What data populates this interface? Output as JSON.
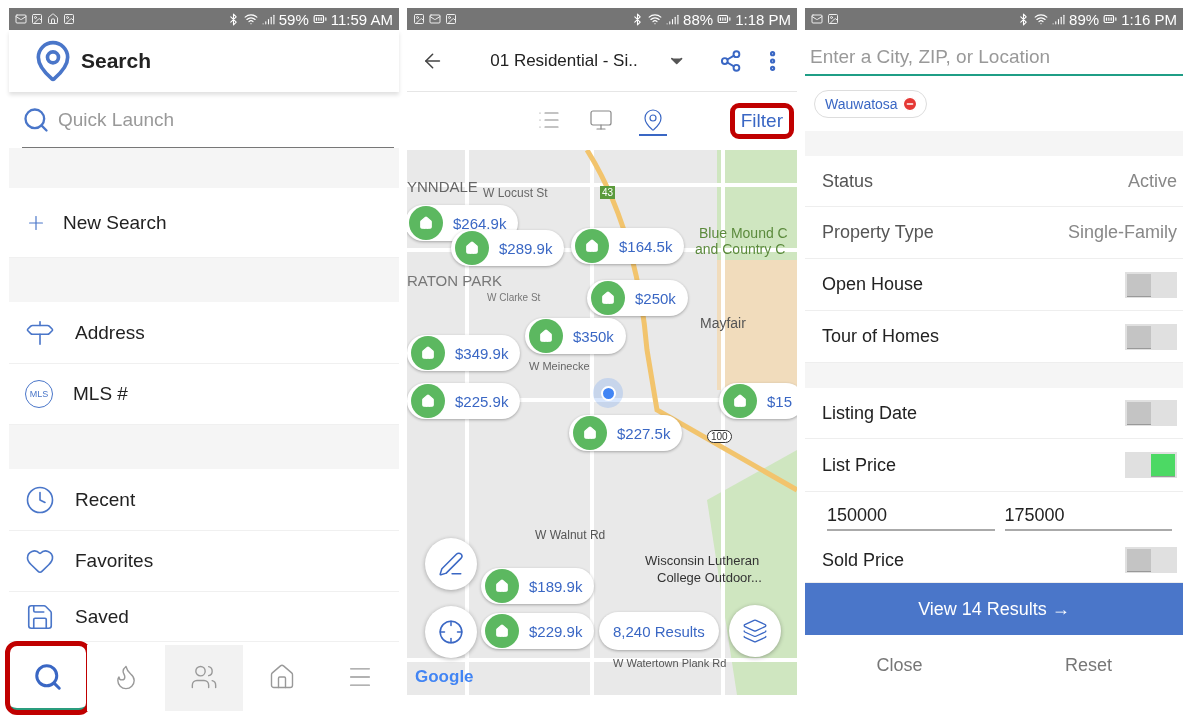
{
  "search_screen": {
    "status_bar": {
      "battery": "59%",
      "time": "11:59 AM"
    },
    "header": {
      "title": "Search"
    },
    "quick_launch": {
      "placeholder": "Quick Launch"
    },
    "groups": [
      [
        {
          "kind": "plus",
          "label": "New Search"
        }
      ],
      [
        {
          "kind": "signpost",
          "label": "Address"
        },
        {
          "kind": "mls",
          "label": "MLS #",
          "badge": "MLS"
        }
      ],
      [
        {
          "kind": "clock",
          "label": "Recent"
        },
        {
          "kind": "heart",
          "label": "Favorites"
        },
        {
          "kind": "floppy",
          "label": "Saved"
        }
      ]
    ],
    "bottom_nav": [
      {
        "kind": "search",
        "selected": true,
        "pressed": false,
        "highlighted": true
      },
      {
        "kind": "flame",
        "selected": false,
        "pressed": false,
        "highlighted": false
      },
      {
        "kind": "people",
        "selected": false,
        "pressed": true,
        "highlighted": false
      },
      {
        "kind": "house",
        "selected": false,
        "pressed": false,
        "highlighted": false
      },
      {
        "kind": "menu",
        "selected": false,
        "pressed": false,
        "highlighted": false
      }
    ]
  },
  "map_screen": {
    "status_bar": {
      "battery": "88%",
      "time": "1:18 PM"
    },
    "header": {
      "title": "01 Residential - Si.."
    },
    "view_tabs": [
      {
        "kind": "list",
        "selected": false
      },
      {
        "kind": "gallery",
        "selected": false
      },
      {
        "kind": "map",
        "selected": true
      }
    ],
    "filter_button": {
      "label": "Filter",
      "highlighted": true
    },
    "map_labels": [
      "YNNDALE",
      "W Locust St",
      "RATON PARK",
      "W Clarke St",
      "Blue Mound C",
      "and Country C",
      "Mayfair",
      "W Meinecke",
      "W Walnut Rd",
      "Wisconsin Lutheran",
      "College Outdoor...",
      "W Watertown Plank Rd",
      "43",
      "100"
    ],
    "pins": [
      "$264.9k",
      "$289.9k",
      "$164.5k",
      "$250k",
      "$350k",
      "$349.9k",
      "$225.9k",
      "$227.5k",
      "$15",
      "$189.9k",
      "$229.9k"
    ],
    "results": "8,240 Results",
    "attribution": "Google"
  },
  "filter_screen": {
    "status_bar": {
      "battery": "89%",
      "time": "1:16 PM"
    },
    "location": {
      "placeholder": "Enter a City, ZIP, or Location"
    },
    "chips": [
      "Wauwatosa"
    ],
    "sections": [
      [
        {
          "kind": "value",
          "label": "Status",
          "value": "Active"
        },
        {
          "kind": "value",
          "label": "Property Type",
          "value": "Single-Family"
        },
        {
          "kind": "toggle",
          "label": "Open House",
          "on": false
        },
        {
          "kind": "toggle",
          "label": "Tour of Homes",
          "on": false
        }
      ],
      [
        {
          "kind": "toggle",
          "label": "Listing Date",
          "on": false
        },
        {
          "kind": "toggle",
          "label": "List Price",
          "on": true
        },
        {
          "kind": "range",
          "min": "150000",
          "max": "175000"
        },
        {
          "kind": "toggle",
          "label": "Sold Price",
          "on": false
        }
      ]
    ],
    "view_button": "View 14 Results →",
    "footer": [
      "Close",
      "Reset"
    ]
  }
}
